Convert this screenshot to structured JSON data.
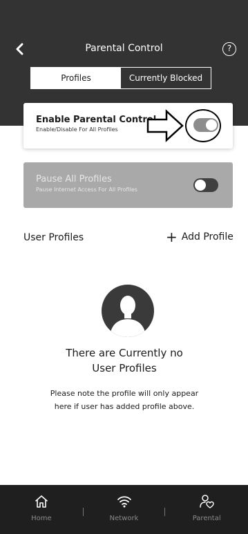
{
  "header": {
    "title": "Parental Control",
    "help_glyph": "?",
    "back_icon": "chevron-left-icon"
  },
  "tabs": [
    {
      "label": "Profiles",
      "active": true
    },
    {
      "label": "Currently Blocked",
      "active": false
    }
  ],
  "enable_card": {
    "title": "Enable Parental Control",
    "subtitle": "Enable/Disable For All Profiles",
    "toggle_on": true
  },
  "pause_card": {
    "title": "Pause All Profiles",
    "subtitle": "Pause Internet Access For All Profiles",
    "toggle_on": false
  },
  "profiles_section": {
    "label": "User Profiles",
    "add_label": "Add Profile",
    "add_glyph": "+"
  },
  "empty_state": {
    "title": "There are Currently no\nUser Profiles",
    "note": "Please note the profile will only appear here if user has added profile above."
  },
  "bottom_nav": [
    {
      "label": "Home",
      "icon": "home-icon"
    },
    {
      "label": "Network",
      "icon": "wifi-icon"
    },
    {
      "label": "Parental",
      "icon": "parental-icon"
    }
  ],
  "colors": {
    "header_bg": "#333333",
    "card_disabled_bg": "#a9a9a9",
    "nav_bg": "#1f1f1f",
    "nav_label": "#8a8a8a"
  }
}
